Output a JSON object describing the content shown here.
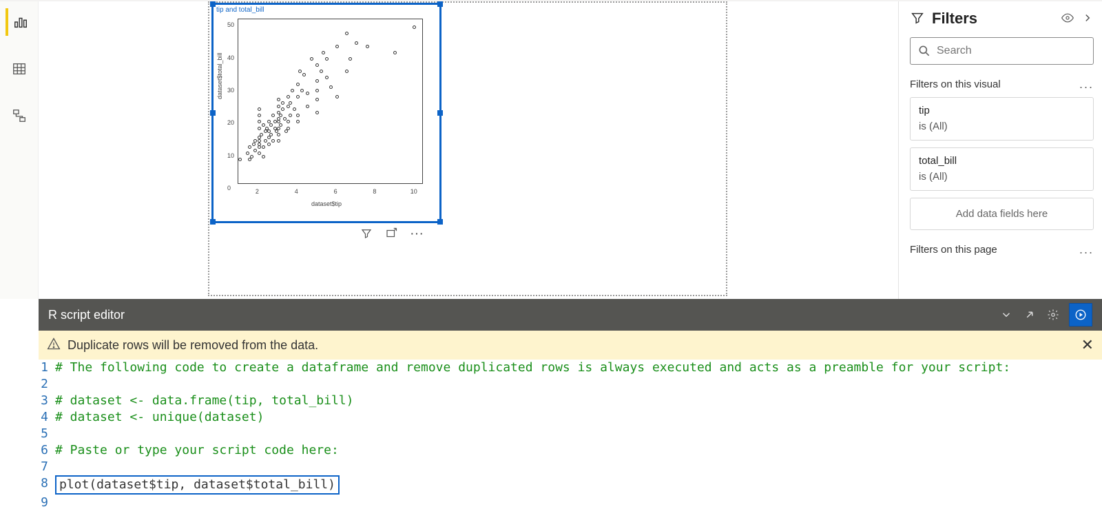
{
  "filters": {
    "title": "Filters",
    "search_placeholder": "Search",
    "section_visual": "Filters on this visual",
    "section_page": "Filters on this page",
    "add_placeholder": "Add data fields here",
    "cards": [
      {
        "name": "tip",
        "sub": "is (All)"
      },
      {
        "name": "total_bill",
        "sub": "is (All)"
      }
    ]
  },
  "visual": {
    "title": "tip and total_bill",
    "xlabel": "dataset$tip",
    "ylabel": "dataset$total_bill",
    "xticks": [
      "2",
      "4",
      "6",
      "8",
      "10"
    ],
    "yticks": [
      "0",
      "10",
      "20",
      "30",
      "40",
      "50"
    ]
  },
  "chart_data": {
    "type": "scatter",
    "title": "tip and total_bill",
    "xlabel": "dataset$tip",
    "ylabel": "dataset$total_bill",
    "xlim": [
      1,
      10.5
    ],
    "ylim": [
      0,
      52
    ],
    "series": [
      {
        "name": "points",
        "x": [
          1.0,
          1.4,
          1.5,
          1.5,
          1.6,
          1.7,
          1.8,
          1.8,
          2.0,
          2.0,
          2.0,
          2.0,
          2.0,
          2.0,
          2.0,
          2.0,
          2.0,
          2.1,
          2.2,
          2.2,
          2.2,
          2.3,
          2.3,
          2.4,
          2.5,
          2.5,
          2.5,
          2.5,
          2.6,
          2.6,
          2.7,
          2.7,
          2.8,
          2.8,
          2.9,
          3.0,
          3.0,
          3.0,
          3.0,
          3.0,
          3.0,
          3.0,
          3.0,
          3.1,
          3.1,
          3.2,
          3.2,
          3.3,
          3.4,
          3.5,
          3.5,
          3.5,
          3.5,
          3.6,
          3.6,
          3.7,
          3.8,
          4.0,
          4.0,
          4.0,
          4.0,
          4.1,
          4.2,
          4.3,
          4.5,
          4.5,
          4.7,
          5.0,
          5.0,
          5.0,
          5.0,
          5.0,
          5.2,
          5.3,
          5.5,
          5.5,
          5.7,
          6.0,
          6.0,
          6.5,
          6.5,
          6.7,
          7.0,
          7.6,
          9.0,
          10.0
        ],
        "y": [
          8,
          10,
          12,
          8,
          9,
          13,
          11,
          14,
          10,
          12,
          13,
          14,
          15,
          18,
          20,
          22,
          24,
          16,
          9,
          12,
          19,
          14,
          17,
          18,
          13,
          15,
          17,
          20,
          16,
          19,
          14,
          22,
          18,
          20,
          17,
          14,
          16,
          18,
          20,
          21,
          23,
          25,
          27,
          19,
          22,
          24,
          26,
          21,
          17,
          18,
          20,
          25,
          28,
          22,
          26,
          30,
          24,
          20,
          22,
          28,
          32,
          36,
          30,
          35,
          25,
          29,
          40,
          23,
          27,
          30,
          33,
          38,
          36,
          42,
          34,
          40,
          31,
          28,
          44,
          36,
          48,
          40,
          45,
          44,
          42,
          50
        ]
      }
    ]
  },
  "editor": {
    "title": "R script editor",
    "warning": "Duplicate rows will be removed from the data.",
    "lines": [
      {
        "n": "1",
        "text": "# The following code to create a dataframe and remove duplicated rows is always executed and acts as a preamble for your script:",
        "comment": true
      },
      {
        "n": "2",
        "text": "",
        "comment": true
      },
      {
        "n": "3",
        "text": "# dataset <- data.frame(tip, total_bill)",
        "comment": true
      },
      {
        "n": "4",
        "text": "# dataset <- unique(dataset)",
        "comment": true
      },
      {
        "n": "5",
        "text": "",
        "comment": true
      },
      {
        "n": "6",
        "text": "# Paste or type your script code here:",
        "comment": true
      },
      {
        "n": "7",
        "text": "",
        "comment": true
      },
      {
        "n": "8",
        "text": "plot(dataset$tip, dataset$total_bill)",
        "comment": false,
        "highlight": true
      },
      {
        "n": "9",
        "text": "",
        "comment": false
      }
    ]
  }
}
